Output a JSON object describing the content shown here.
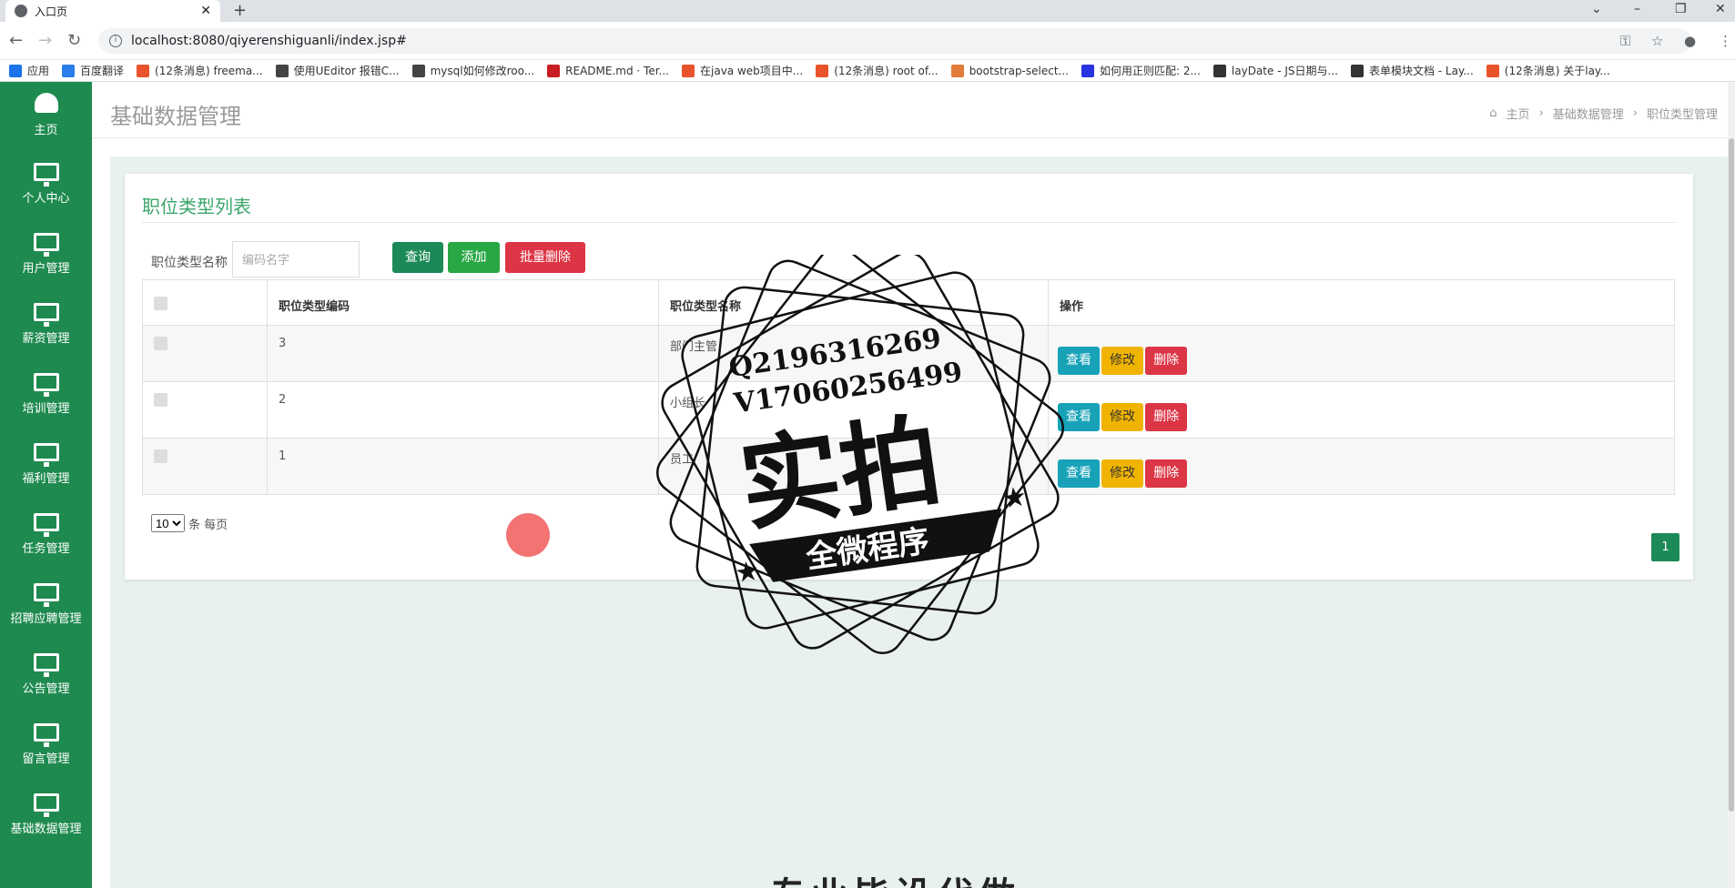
{
  "browser": {
    "tab_title": "入口页",
    "url": "localhost:8080/qiyerenshiguanli/index.jsp#",
    "bookmarks": [
      {
        "label": "应用",
        "color": "#1a73e8"
      },
      {
        "label": "百度翻译",
        "color": "#2b7de9"
      },
      {
        "label": "(12条消息) freema...",
        "color": "#e9532c"
      },
      {
        "label": "使用UEditor 报错C...",
        "color": "#444"
      },
      {
        "label": "mysql如何修改roo...",
        "color": "#444"
      },
      {
        "label": "README.md · Ter...",
        "color": "#c71d23"
      },
      {
        "label": "在java web项目中...",
        "color": "#e9532c"
      },
      {
        "label": "(12条消息) root of...",
        "color": "#e9532c"
      },
      {
        "label": "bootstrap-select...",
        "color": "#e07b39"
      },
      {
        "label": "如何用正则匹配: 2...",
        "color": "#2932e1"
      },
      {
        "label": "layDate - JS日期与...",
        "color": "#333"
      },
      {
        "label": "表单模块文档 - Lay...",
        "color": "#333"
      },
      {
        "label": "(12条消息) 关于lay...",
        "color": "#e9532c"
      }
    ]
  },
  "sidebar": {
    "items": [
      {
        "label": "主页",
        "icon": "dashboard-icon"
      },
      {
        "label": "个人中心",
        "icon": "monitor-icon"
      },
      {
        "label": "用户管理",
        "icon": "monitor-icon"
      },
      {
        "label": "薪资管理",
        "icon": "monitor-icon"
      },
      {
        "label": "培训管理",
        "icon": "monitor-icon"
      },
      {
        "label": "福利管理",
        "icon": "monitor-icon"
      },
      {
        "label": "任务管理",
        "icon": "monitor-icon"
      },
      {
        "label": "招聘应聘管理",
        "icon": "monitor-icon"
      },
      {
        "label": "公告管理",
        "icon": "monitor-icon"
      },
      {
        "label": "留言管理",
        "icon": "monitor-icon"
      },
      {
        "label": "基础数据管理",
        "icon": "monitor-icon"
      }
    ]
  },
  "header": {
    "title": "基础数据管理",
    "breadcrumb": [
      "主页",
      "基础数据管理",
      "职位类型管理"
    ]
  },
  "card": {
    "title": "职位类型列表",
    "search_label": "职位类型名称",
    "search_placeholder": "编码名字",
    "btn_query": "查询",
    "btn_add": "添加",
    "btn_batch_delete": "批量删除"
  },
  "table": {
    "headers": [
      "职位类型编码",
      "职位类型名称",
      "操作"
    ],
    "rows": [
      {
        "code": "3",
        "name": "部门主管"
      },
      {
        "code": "2",
        "name": "小组长"
      },
      {
        "code": "1",
        "name": "员工"
      }
    ],
    "actions": {
      "view": "查看",
      "edit": "修改",
      "delete": "删除"
    }
  },
  "pagination": {
    "page_size": "10",
    "page_size_suffix": "条 每页",
    "current_page": "1"
  },
  "watermark": {
    "line1": "Q2196316269",
    "line2": "V17060256499",
    "big": "实拍",
    "banner": "全微程序"
  },
  "bottom_text": "专业毕设代做",
  "colors": {
    "sidebar": "#1e8a4f",
    "accent": "#3aa66a",
    "primary": "#1c8a57"
  }
}
